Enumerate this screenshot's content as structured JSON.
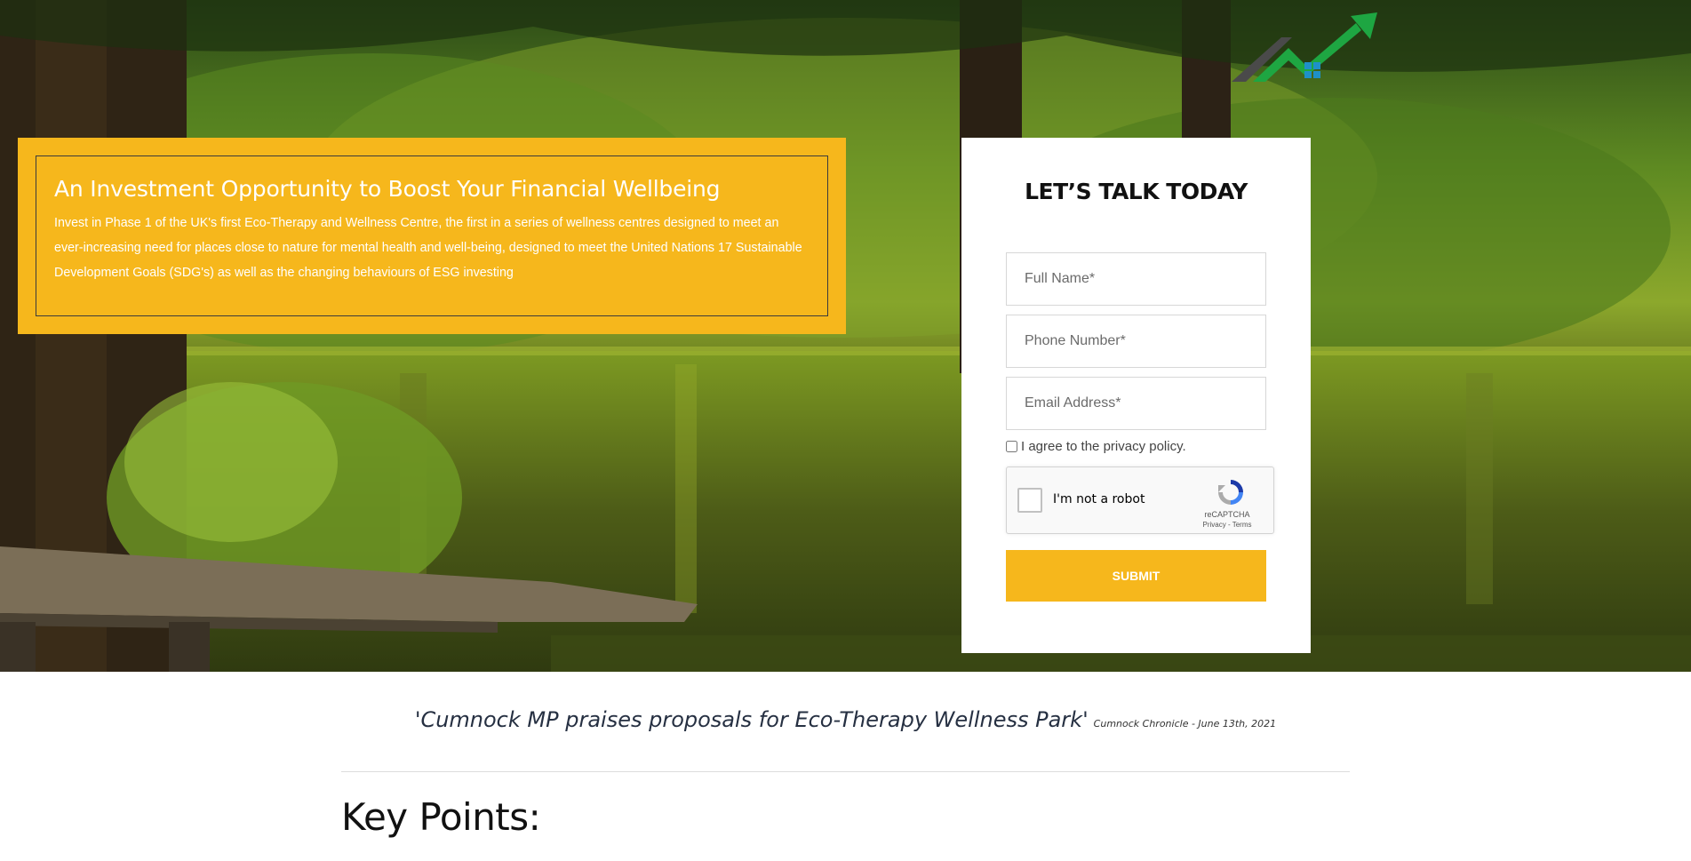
{
  "hero": {
    "info": {
      "title": "An Investment Opportunity to Boost Your Financial Wellbeing",
      "body": "Invest in Phase 1 of the UK's first Eco-Therapy and Wellness Centre, the first in a series of wellness centres designed to meet an ever-increasing need for places close to nature for mental health and well-being, designed to meet the United Nations 17 Sustainable Development Goals (SDG's) as well as the changing behaviours of ESG investing"
    },
    "logo_icon": "rising-arrow-house-icon"
  },
  "form": {
    "title": "LET’S TALK TODAY",
    "full_name_placeholder": "Full Name*",
    "phone_placeholder": "Phone Number*",
    "email_placeholder": "Email Address*",
    "privacy_label": "I agree to the privacy policy.",
    "captcha": {
      "label": "I'm not a robot",
      "brand": "reCAPTCHA",
      "links": "Privacy - Terms"
    },
    "submit_label": "SUBMIT"
  },
  "quote": {
    "text": "'Cumnock MP praises proposals for Eco-Therapy Wellness Park'",
    "source": "Cumnock Chronicle - June 13th, 2021"
  },
  "key_points": {
    "heading": "Key Points:"
  },
  "colors": {
    "accent": "#f6b71c",
    "quote_text": "#263042"
  }
}
